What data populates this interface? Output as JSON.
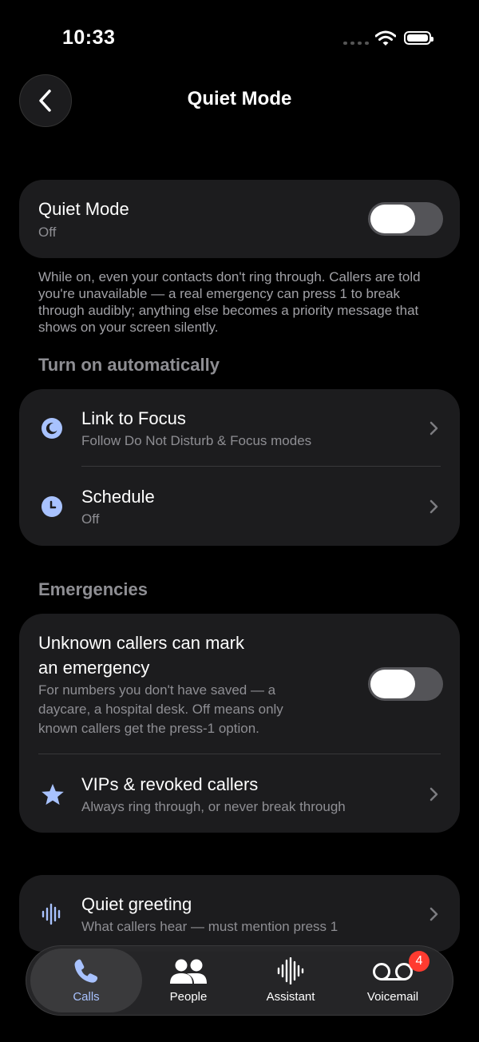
{
  "status_bar": {
    "time": "10:33"
  },
  "header": {
    "title": "Quiet Mode"
  },
  "quiet_mode": {
    "label": "Quiet Mode",
    "state": "Off",
    "toggle_on": false,
    "description": "While on, even your contacts don't ring through. Callers are told you're unavailable — a real emergency can press 1 to break through audibly; anything else becomes a priority message that shows on your screen silently."
  },
  "auto_section": {
    "title": "Turn on automatically",
    "items": [
      {
        "label": "Link to Focus",
        "sub": "Follow Do Not Disturb & Focus modes",
        "icon": "moon-icon"
      },
      {
        "label": "Schedule",
        "sub": "Off",
        "icon": "clock-icon"
      }
    ]
  },
  "emergencies_section": {
    "title": "Emergencies",
    "unknown_callers": {
      "label_line1": "Unknown callers can mark",
      "label_line2": "an emergency",
      "sub_line1": "For numbers you don't have saved — a",
      "sub_line2": "daycare, a hospital desk. Off means only",
      "sub_line3": "known callers get the press-1 option.",
      "toggle_on": false
    },
    "vips": {
      "label": "VIPs & revoked callers",
      "sub": "Always ring through, or never break through",
      "icon": "star-icon"
    }
  },
  "greeting": {
    "label": "Quiet greeting",
    "sub": "What callers hear — must mention press 1",
    "icon": "waveform-icon"
  },
  "tab_bar": {
    "tabs": [
      {
        "label": "Calls",
        "icon": "phone-icon",
        "active": true
      },
      {
        "label": "People",
        "icon": "people-icon",
        "active": false
      },
      {
        "label": "Assistant",
        "icon": "waveform-icon",
        "active": false
      },
      {
        "label": "Voicemail",
        "icon": "voicemail-icon",
        "active": false,
        "badge": "4"
      }
    ]
  },
  "colors": {
    "accent": "#a8c2ff",
    "badge": "#ff3b30",
    "card": "#1c1c1e"
  }
}
